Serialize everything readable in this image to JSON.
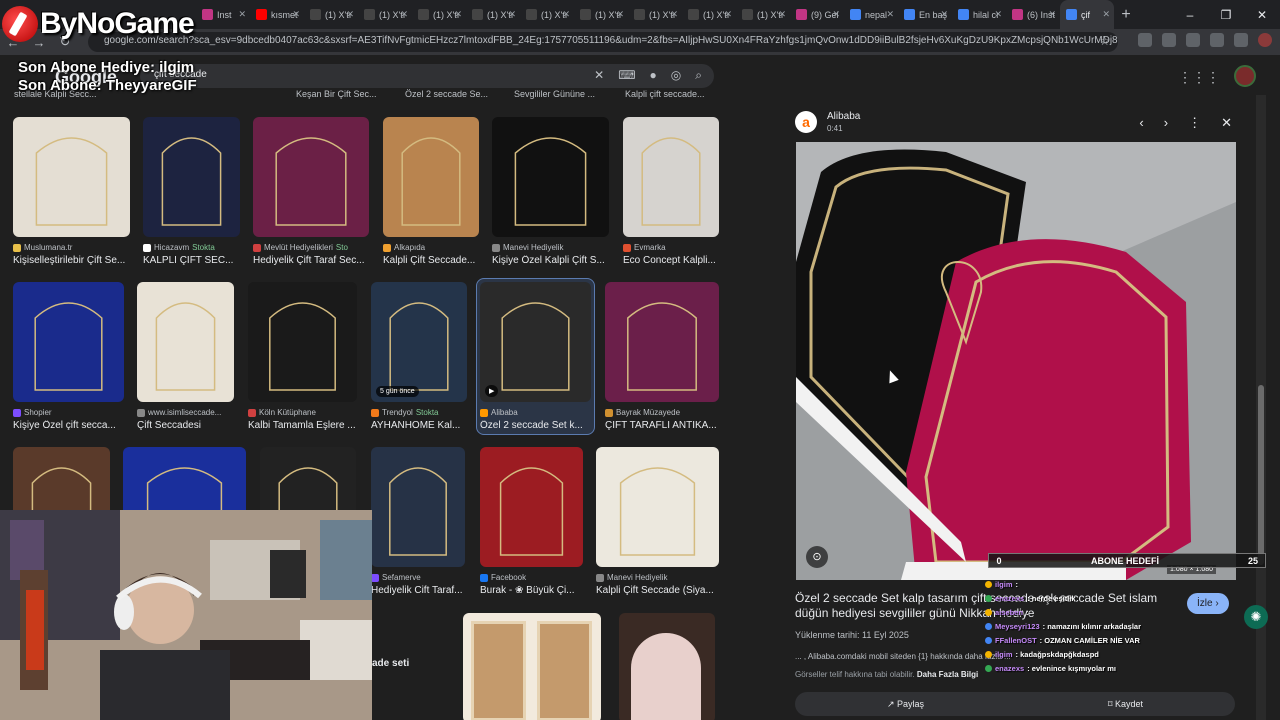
{
  "browser": {
    "tabs": [
      {
        "label": "Inst",
        "color": "#c13584",
        "icon": "instagram-icon"
      },
      {
        "label": "kısmet",
        "color": "#ff0000",
        "icon": "youtube-icon"
      },
      {
        "label": "(1) X'tı",
        "color": "#444444",
        "icon": "x-icon"
      },
      {
        "label": "(1) X'tı",
        "color": "#444444",
        "icon": "x-icon"
      },
      {
        "label": "(1) X'tı",
        "color": "#444444",
        "icon": "x-icon"
      },
      {
        "label": "(1) X'tı",
        "color": "#444444",
        "icon": "x-icon"
      },
      {
        "label": "(1) X'tı",
        "color": "#444444",
        "icon": "x-icon"
      },
      {
        "label": "(1) X'tı",
        "color": "#444444",
        "icon": "x-icon"
      },
      {
        "label": "(1) X'tı",
        "color": "#444444",
        "icon": "x-icon"
      },
      {
        "label": "(1) X'tı",
        "color": "#444444",
        "icon": "x-icon"
      },
      {
        "label": "(1) X'tı",
        "color": "#444444",
        "icon": "x-icon"
      },
      {
        "label": "(9) Gel",
        "color": "#c13584",
        "icon": "instagram-icon"
      },
      {
        "label": "nepal",
        "color": "#4285f4",
        "icon": "google-icon"
      },
      {
        "label": "En baş",
        "color": "#4285f4",
        "icon": "google-icon"
      },
      {
        "label": "hilal cı",
        "color": "#4285f4",
        "icon": "google-icon"
      },
      {
        "label": "(6) Inst",
        "color": "#c13584",
        "icon": "instagram-icon"
      },
      {
        "label": "çif",
        "color": "#4285f4",
        "icon": "google-icon",
        "active": true
      }
    ],
    "url": "google.com/search?sca_esv=9dbcedb0407ac63c&sxsrf=AE3TifNvFgtmicEHzcz7lmtoxdFBB_24Eg:1757705511196&udm=2&fbs=AIljpHwSU0Xn4FRaYzhfgs1jmQvOnw1dDD9iiBulB2fsjeHv6XuKgDzU9KpxZMcpsjQNb1WcUrMDj8VH-V1nllcq..."
  },
  "google": {
    "logo": "Google",
    "query": "çift seccade"
  },
  "results": {
    "top_titles": [
      "stellale Kalpli Secc...",
      "Keşan Bir Çift Sec...",
      "Özel 2 seccade Se...",
      "Sevgililer Gününe ...",
      "Kalpli çift seccade..."
    ],
    "row1": [
      {
        "source": "Muslumana.tr",
        "stock": "",
        "title": "Kişiselleştirilebir Çift Se...",
        "bg": "#e4ded3",
        "fav": "#e8c04a"
      },
      {
        "source": "Hicazavm",
        "stock": "Stokta",
        "title": "KALPLİ ÇİFT SEC...",
        "bg": "#1d2340",
        "fav": "#ffffff"
      },
      {
        "source": "Mevlüt Hediyelikleri",
        "stock": "Sto",
        "title": "Hediyelik Çift Taraf Sec...",
        "bg": "#6b2046",
        "fav": "#d04040"
      },
      {
        "source": "Alkapıda",
        "stock": "",
        "title": "Kalpli Çift Seccade...",
        "bg": "#b9844f",
        "fav": "#f0a030"
      },
      {
        "source": "Manevi Hediyelik",
        "stock": "",
        "title": "Kişiye Özel Kalpli Çift S...",
        "bg": "#111111",
        "fav": "#888888"
      },
      {
        "source": "Evmarka",
        "stock": "",
        "title": "Eco Concept Kalpli...",
        "bg": "#d6d3cf",
        "fav": "#e05030"
      }
    ],
    "row2": [
      {
        "source": "Shopier",
        "stock": "",
        "title": "Kişiye Özel çift secca...",
        "bg": "#1a2b8c",
        "fav": "#7c4dff"
      },
      {
        "source": "www.isimliseccade...",
        "stock": "",
        "title": "Çift Seccadesi",
        "bg": "#e8e2d6",
        "fav": "#888888"
      },
      {
        "source": "Köln Kütüphane",
        "stock": "",
        "title": "Kalbi Tamamla Eşlere ...",
        "bg": "#1a1a1a",
        "fav": "#d04040"
      },
      {
        "source": "Trendyol",
        "stock": "Stokta",
        "title": "AYHANHOME Kal...",
        "bg": "#24344a",
        "fav": "#f27a1a",
        "badge": "5 gün önce"
      },
      {
        "source": "Alibaba",
        "stock": "",
        "title": "Özel 2 seccade Set k...",
        "bg": "#2a2a2a",
        "fav": "#ff9900",
        "badge": "▶",
        "selected": true
      },
      {
        "source": "Bayrak Müzayede",
        "stock": "",
        "title": "ÇİFT TARAFLI ANTİKA...",
        "bg": "#6b1f4a",
        "fav": "#d09030"
      }
    ],
    "row3": [
      {
        "source": "",
        "stock": "",
        "title": "",
        "bg": "#5a3a2a",
        "fav": "#888888"
      },
      {
        "source": "",
        "stock": "",
        "title": "",
        "bg": "#1a2f9c",
        "fav": "#888888"
      },
      {
        "source": "",
        "stock": "",
        "title": "",
        "bg": "#222222",
        "fav": "#888888"
      },
      {
        "source": "Sefamerve",
        "stock": "",
        "title": "Hediyelik Cift Taraf...",
        "bg": "#263246",
        "fav": "#7c4dff"
      },
      {
        "source": "Facebook",
        "stock": "",
        "title": "Burak - ❀ Büyük Çi...",
        "bg": "#9c1c22",
        "fav": "#1877f2"
      },
      {
        "source": "Manevi Hediyelik",
        "stock": "",
        "title": "Kalpli Çift Seccade (Siya...",
        "bg": "#ece8de",
        "fav": "#888888"
      }
    ],
    "row4_partial_title": "ade seti"
  },
  "panel": {
    "site": "Alibaba",
    "duration": "0:41",
    "title": "Özel 2 seccade Set kalp tasarım çift seccade aşk seccade Set islam düğün hediyesi sevgililer günü Nikkah hediye",
    "watch_label": "İzle",
    "upload_date": "Yüklenme tarihi: 11 Eyl 2025",
    "description": "... , Alibaba.comdaki mobil siteden {1} hakkında daha fazla ...",
    "license": "Görseller telif hakkına tabi olabilir.",
    "license_link": "Daha Fazla Bilgi",
    "image_dims": "1.080 × 1.080",
    "share_label": "Paylaş",
    "save_label": "Kaydet"
  },
  "overlay": {
    "brand": "ByNoGame",
    "last_donation": "Son Abone Hediye: ilgim",
    "last_sub": "Son Abone: TheyyareGIF",
    "goal": {
      "current": "0",
      "label": "ABONE HEDEFİ",
      "target": "25"
    },
    "chat": [
      {
        "user": "ilgim",
        "text": ":",
        "badge": "#f4b400"
      },
      {
        "user": "enazexs",
        "text": ": nerde eşitlik",
        "badge": "#34a853"
      },
      {
        "user": "aiseben",
        "text": ":",
        "badge": "#f4b400"
      },
      {
        "user": "Meyseyri123",
        "text": ": namazını kılınır arkadaşlar",
        "badge": "#4285f4"
      },
      {
        "user": "FFallenOST",
        "text": ": OZMAN CAMİLER NİE VAR",
        "badge": "#4285f4"
      },
      {
        "user": "ilgim",
        "text": ": kadağpskdapğkdaspd",
        "badge": "#f4b400"
      },
      {
        "user": "enazexs",
        "text": ": evlenince kışmıyolar mı",
        "badge": "#34a853"
      }
    ]
  }
}
